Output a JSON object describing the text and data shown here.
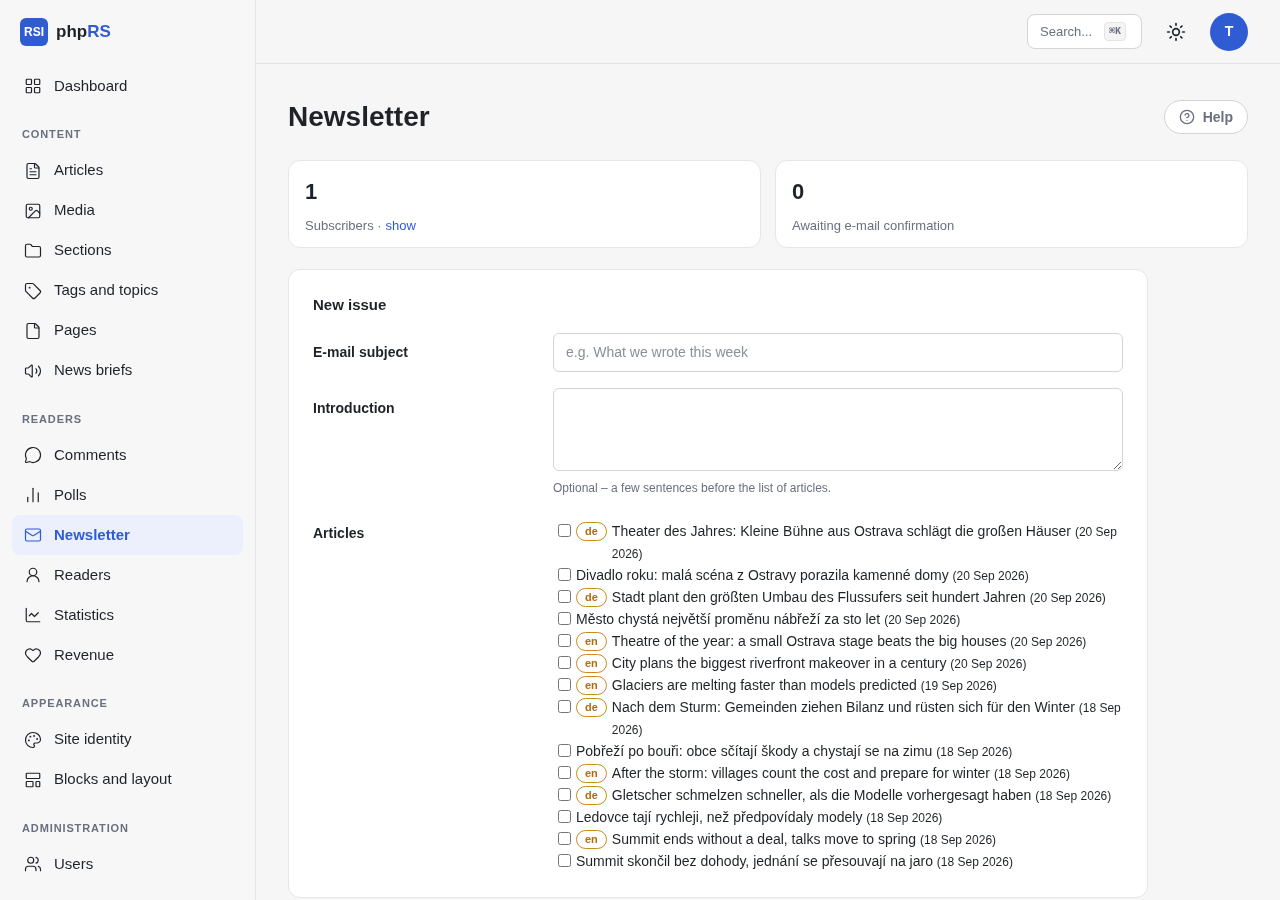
{
  "brand": {
    "mark": "RSI",
    "name_plain": "php",
    "name_accent": "RS"
  },
  "sidebar": {
    "top": [
      {
        "label": "Dashboard",
        "selected": false
      }
    ],
    "sections": [
      {
        "heading": "CONTENT",
        "items": [
          {
            "label": "Articles",
            "selected": false
          },
          {
            "label": "Media",
            "selected": false
          },
          {
            "label": "Sections",
            "selected": false
          },
          {
            "label": "Tags and topics",
            "selected": false
          },
          {
            "label": "Pages",
            "selected": false
          },
          {
            "label": "News briefs",
            "selected": false
          }
        ]
      },
      {
        "heading": "READERS",
        "items": [
          {
            "label": "Comments",
            "selected": false
          },
          {
            "label": "Polls",
            "selected": false
          },
          {
            "label": "Newsletter",
            "selected": true
          },
          {
            "label": "Readers",
            "selected": false
          },
          {
            "label": "Statistics",
            "selected": false
          },
          {
            "label": "Revenue",
            "selected": false
          }
        ]
      },
      {
        "heading": "APPEARANCE",
        "items": [
          {
            "label": "Site identity",
            "selected": false
          },
          {
            "label": "Blocks and layout",
            "selected": false
          }
        ]
      },
      {
        "heading": "ADMINISTRATION",
        "items": [
          {
            "label": "Users",
            "selected": false
          }
        ]
      }
    ]
  },
  "topbar": {
    "search_placeholder": "Search...",
    "shortcut": "⌘K",
    "avatar": "T"
  },
  "page": {
    "title": "Newsletter",
    "help": "Help"
  },
  "stats": [
    {
      "value": "1",
      "label": "Subscribers ·",
      "link": "show"
    },
    {
      "value": "0",
      "label": "Awaiting e-mail confirmation"
    }
  ],
  "form": {
    "title": "New issue",
    "subject": {
      "label": "E-mail subject",
      "placeholder": "e.g. What we wrote this week"
    },
    "intro": {
      "label": "Introduction",
      "hint": "Optional – a few sentences before the list of articles."
    },
    "articles_label": "Articles",
    "articles": [
      {
        "lang": "de",
        "title": "Theater des Jahres: Kleine Bühne aus Ostrava schlägt die großen Häuser",
        "date": "(20 Sep 2026)",
        "checked": false
      },
      {
        "title": "Divadlo roku: malá scéna z Ostravy porazila kamenné domy",
        "date": "(20 Sep 2026)",
        "checked": false
      },
      {
        "lang": "de",
        "title": "Stadt plant den größten Umbau des Flussufers seit hundert Jahren",
        "date": "(20 Sep 2026)",
        "checked": false
      },
      {
        "title": "Město chystá největší proměnu nábřeží za sto let",
        "date": "(20 Sep 2026)",
        "checked": false
      },
      {
        "lang": "en",
        "title": "Theatre of the year: a small Ostrava stage beats the big houses",
        "date": "(20 Sep 2026)",
        "checked": false
      },
      {
        "lang": "en",
        "title": "City plans the biggest riverfront makeover in a century",
        "date": "(20 Sep 2026)",
        "checked": false
      },
      {
        "lang": "en",
        "title": "Glaciers are melting faster than models predicted",
        "date": "(19 Sep 2026)",
        "checked": false
      },
      {
        "lang": "de",
        "title": "Nach dem Sturm: Gemeinden ziehen Bilanz und rüsten sich für den Winter",
        "date": "(18 Sep 2026)",
        "checked": false
      },
      {
        "title": "Pobřeží po bouři: obce sčítají škody a chystají se na zimu",
        "date": "(18 Sep 2026)",
        "checked": false
      },
      {
        "lang": "en",
        "title": "After the storm: villages count the cost and prepare for winter",
        "date": "(18 Sep 2026)",
        "checked": false
      },
      {
        "lang": "de",
        "title": "Gletscher schmelzen schneller, als die Modelle vorhergesagt haben",
        "date": "(18 Sep 2026)",
        "checked": false
      },
      {
        "title": "Ledovce tají rychleji, než předpovídaly modely",
        "date": "(18 Sep 2026)",
        "checked": false
      },
      {
        "lang": "en",
        "title": "Summit ends without a deal, talks move to spring",
        "date": "(18 Sep 2026)",
        "checked": false
      },
      {
        "title": "Summit skončil bez dohody, jednání se přesouvají na jaro",
        "date": "(18 Sep 2026)",
        "checked": false
      }
    ]
  }
}
